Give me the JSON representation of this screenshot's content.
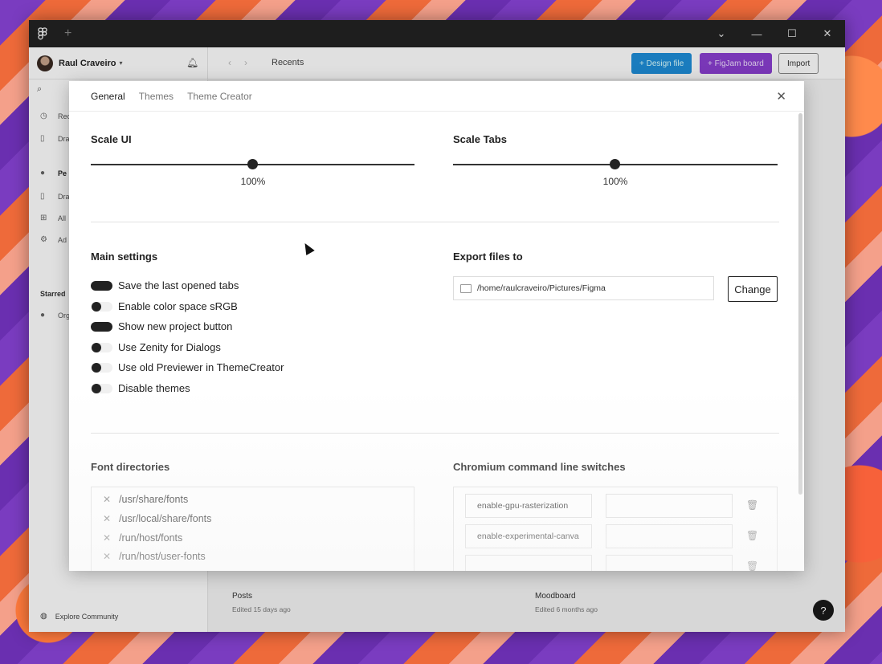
{
  "window": {
    "logo_icon": "figma-logo-icon",
    "new_tab_symbol": "+",
    "controls": [
      "⌄",
      "—",
      "☐",
      "✕"
    ]
  },
  "toolbar": {
    "user_name": "Raul Craveiro",
    "breadcrumb": "Recents",
    "design_file_label": "+ Design file",
    "figjam_label": "+ FigJam board",
    "import_label": "Import"
  },
  "sidebar": {
    "items": [
      {
        "label": "Rec",
        "icon": "clock-icon"
      },
      {
        "label": "Dra",
        "icon": "file-icon"
      },
      {
        "label": "Pe",
        "icon": "team-icon"
      },
      {
        "label": "Dra",
        "icon": "file-icon"
      },
      {
        "label": "All",
        "icon": "grid-icon"
      },
      {
        "label": "Ad",
        "icon": "sliders-icon"
      }
    ],
    "starred_label": "Starred",
    "starred_item": "Org",
    "explore_label": "Explore Community"
  },
  "files": [
    {
      "name": "Posts",
      "meta": "Edited 15 days ago"
    },
    {
      "name": "Moodboard",
      "meta": "Edited 6 months ago"
    }
  ],
  "help_symbol": "?",
  "modal": {
    "tabs": [
      "General",
      "Themes",
      "Theme Creator"
    ],
    "active_tab": "General",
    "scale_ui": {
      "title": "Scale UI",
      "value": "100%"
    },
    "scale_tabs": {
      "title": "Scale Tabs",
      "value": "100%"
    },
    "main_settings": {
      "title": "Main settings",
      "items": [
        {
          "label": "Save the last opened tabs",
          "enabled": true
        },
        {
          "label": "Enable color space sRGB",
          "enabled": false
        },
        {
          "label": "Show new project button",
          "enabled": true
        },
        {
          "label": "Use Zenity for Dialogs",
          "enabled": false
        },
        {
          "label": "Use old Previewer in ThemeCreator",
          "enabled": false
        },
        {
          "label": "Disable themes",
          "enabled": false
        }
      ]
    },
    "export": {
      "title": "Export files to",
      "path": "/home/raulcraveiro/Pictures/Figma",
      "change_label": "Change"
    },
    "font_directories": {
      "title": "Font directories",
      "items": [
        "/usr/share/fonts",
        "/usr/local/share/fonts",
        "/run/host/fonts",
        "/run/host/user-fonts"
      ]
    },
    "chromium_switches": {
      "title": "Chromium command line switches",
      "items": [
        {
          "name": "enable-gpu-rasterization",
          "value": ""
        },
        {
          "name": "enable-experimental-canva",
          "value": ""
        },
        {
          "name": "",
          "value": ""
        }
      ]
    }
  }
}
